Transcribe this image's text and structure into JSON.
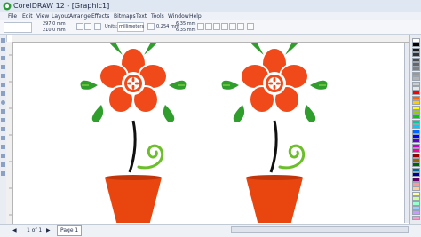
{
  "window": {
    "title": "CorelDRAW 12 - [Graphic1]"
  },
  "menu": {
    "items": [
      "File",
      "Edit",
      "View",
      "Layout",
      "Arrange",
      "Effects",
      "Bitmaps",
      "Text",
      "Tools",
      "Window",
      "Help"
    ]
  },
  "propbar": {
    "width_value": "297.0 mm",
    "height_value": "210.0 mm",
    "units_label": "Units:",
    "units_value": "millimeters",
    "nudge_value": "0.254 mm",
    "dup_x": "6.35 mm",
    "dup_y": "6.35 mm"
  },
  "status": {
    "page_counter": "1 of 1",
    "page_tab": "Page 1"
  },
  "colors": {
    "petal": "#f04a1a",
    "petal_outline": "#ffffff",
    "center": "#f04a1a",
    "leaf": "#2f9e2c",
    "leaf_light": "#7bc843",
    "stem": "#111111",
    "pot": "#e8450f",
    "pot_shadow": "#c2350a",
    "spiral": "#6cbf2a"
  },
  "palette": {
    "swatches": [
      "#ffffff",
      "#000000",
      "#1a1a1a",
      "#333333",
      "#4d4d4d",
      "#666666",
      "#808080",
      "#999999",
      "#b3b3b3",
      "#cccccc",
      "#e6e6e6",
      "#ff0000",
      "#ff6600",
      "#ffcc00",
      "#ffff00",
      "#99cc00",
      "#00cc00",
      "#00cc99",
      "#00ccff",
      "#0066ff",
      "#0000ff",
      "#6600cc",
      "#cc00cc",
      "#ff0099",
      "#990000",
      "#996600",
      "#006600",
      "#006699",
      "#000099",
      "#660066",
      "#ff9999",
      "#ffcc99",
      "#ffff99",
      "#ccff99",
      "#99ffcc",
      "#99ccff",
      "#cc99ff",
      "#ff99cc"
    ]
  }
}
